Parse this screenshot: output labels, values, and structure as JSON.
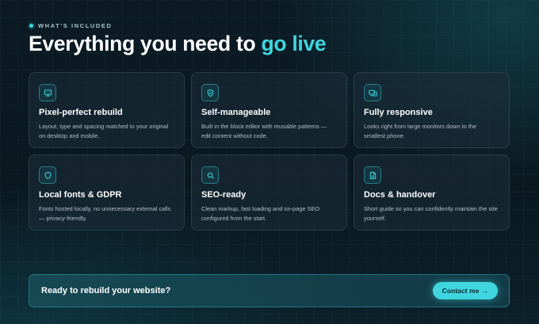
{
  "header": {
    "eyebrow": "WHAT'S INCLUDED",
    "title_main": "Everything you need to ",
    "title_accent": "go live"
  },
  "features": [
    {
      "icon": "monitor-icon",
      "title": "Pixel-perfect rebuild",
      "description": "Layout, type and spacing matched to your original on desktop and mobile."
    },
    {
      "icon": "shield-check-icon",
      "title": "Self-manageable",
      "description": "Built in the block editor with reusable patterns — edit content without code."
    },
    {
      "icon": "devices-icon",
      "title": "Fully responsive",
      "description": "Looks right from large monitors down to the smallest phone."
    },
    {
      "icon": "shield-icon",
      "title": "Local fonts & GDPR",
      "description": "Fonts hosted locally, no unnecessary external calls — privacy-friendly."
    },
    {
      "icon": "search-icon",
      "title": "SEO-ready",
      "description": "Clean markup, fast loading and on-page SEO configured from the start."
    },
    {
      "icon": "document-icon",
      "title": "Docs & handover",
      "description": "Short guide so you can confidently maintain the site yourself."
    }
  ],
  "cta": {
    "text": "Ready to rebuild your website?",
    "button_label": "Contact me",
    "button_arrow": "→"
  },
  "colors": {
    "accent": "#3fd6df",
    "background": "#0b1a24",
    "card": "#1e2e3a"
  }
}
